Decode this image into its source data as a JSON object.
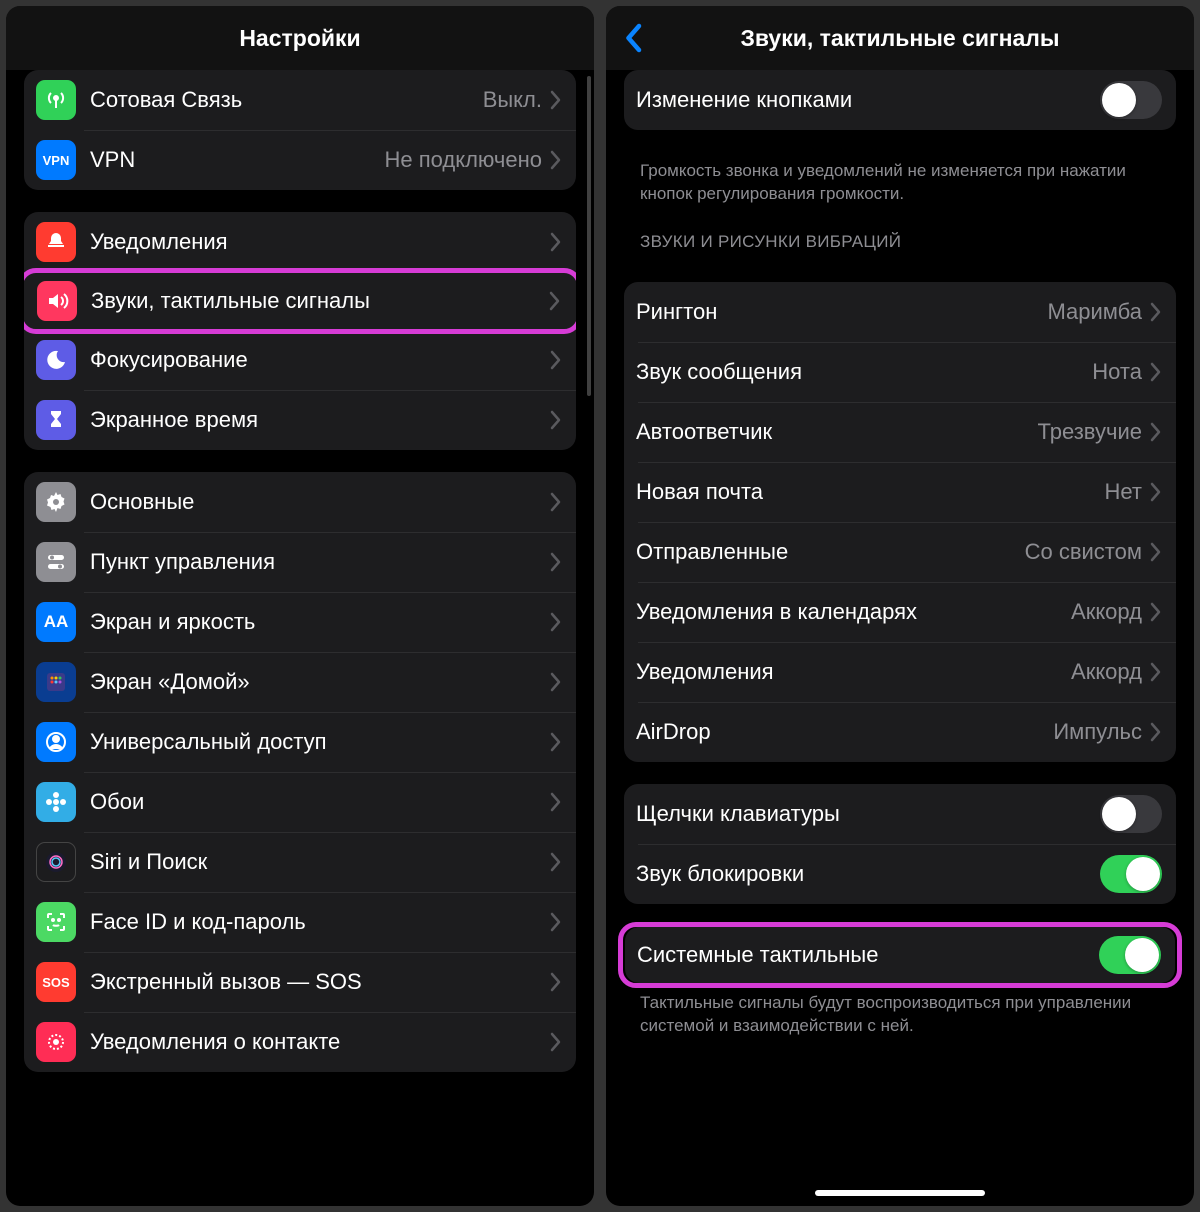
{
  "left": {
    "title": "Настройки",
    "groups": [
      {
        "rows": [
          {
            "name": "cellular",
            "icon": "antenna",
            "iconBg": "bg-green",
            "label": "Сотовая Связь",
            "value": "Выкл."
          },
          {
            "name": "vpn",
            "icon": "vpn",
            "iconBg": "bg-blue",
            "label": "VPN",
            "value": "Не подключено"
          }
        ]
      },
      {
        "rows": [
          {
            "name": "notifications",
            "icon": "bell",
            "iconBg": "bg-red",
            "label": "Уведомления"
          },
          {
            "name": "sounds",
            "icon": "speaker",
            "iconBg": "bg-pink",
            "label": "Звуки, тактильные сигналы",
            "highlight": true
          },
          {
            "name": "focus",
            "icon": "moon",
            "iconBg": "bg-indigo",
            "label": "Фокусирование"
          },
          {
            "name": "screentime",
            "icon": "hourglass",
            "iconBg": "bg-indigo",
            "label": "Экранное время"
          }
        ]
      },
      {
        "rows": [
          {
            "name": "general",
            "icon": "gear",
            "iconBg": "bg-gray",
            "label": "Основные"
          },
          {
            "name": "control-center",
            "icon": "switches",
            "iconBg": "bg-gray",
            "label": "Пункт управления"
          },
          {
            "name": "display",
            "icon": "aa",
            "iconBg": "bg-blue",
            "label": "Экран и яркость"
          },
          {
            "name": "home-screen",
            "icon": "grid",
            "iconBg": "bg-darkblue",
            "label": "Экран «Домой»"
          },
          {
            "name": "accessibility",
            "icon": "person",
            "iconBg": "bg-blue",
            "label": "Универсальный доступ"
          },
          {
            "name": "wallpaper",
            "icon": "flower",
            "iconBg": "bg-cyan",
            "label": "Обои"
          },
          {
            "name": "siri",
            "icon": "siri",
            "iconBg": "bg-black",
            "label": "Siri и Поиск"
          },
          {
            "name": "faceid",
            "icon": "face",
            "iconBg": "bg-ltgreen",
            "label": "Face ID и код-пароль"
          },
          {
            "name": "sos",
            "icon": "sos",
            "iconBg": "bg-sos",
            "label": "Экстренный вызов — SOS"
          },
          {
            "name": "contact-notif",
            "icon": "contact",
            "iconBg": "bg-contact",
            "label": "Уведомления о контакте"
          }
        ]
      }
    ]
  },
  "right": {
    "title": "Звуки, тактильные сигналы",
    "top_row": {
      "label": "Изменение кнопками",
      "on": false
    },
    "top_footer": "Громкость звонка и уведомлений не изменяется при нажатии кнопок регулирования громкости.",
    "sounds_header": "ЗВУКИ И РИСУНКИ ВИБРАЦИЙ",
    "sounds": [
      {
        "name": "ringtone",
        "label": "Рингтон",
        "value": "Маримба"
      },
      {
        "name": "text-tone",
        "label": "Звук сообщения",
        "value": "Нота"
      },
      {
        "name": "voicemail",
        "label": "Автоответчик",
        "value": "Трезвучие"
      },
      {
        "name": "new-mail",
        "label": "Новая почта",
        "value": "Нет"
      },
      {
        "name": "sent-mail",
        "label": "Отправленные",
        "value": "Со свистом"
      },
      {
        "name": "calendar",
        "label": "Уведомления в календарях",
        "value": "Аккорд"
      },
      {
        "name": "reminders",
        "label": "Уведомления",
        "value": "Аккорд"
      },
      {
        "name": "airdrop",
        "label": "AirDrop",
        "value": "Импульс"
      }
    ],
    "toggles2": [
      {
        "name": "keyboard-clicks",
        "label": "Щелчки клавиатуры",
        "on": false
      },
      {
        "name": "lock-sound",
        "label": "Звук блокировки",
        "on": true
      }
    ],
    "haptics": {
      "label": "Системные тактильные",
      "on": true,
      "highlight": true
    },
    "haptics_footer": "Тактильные сигналы будут воспроизводиться при управлении системой и взаимодействии с ней."
  }
}
